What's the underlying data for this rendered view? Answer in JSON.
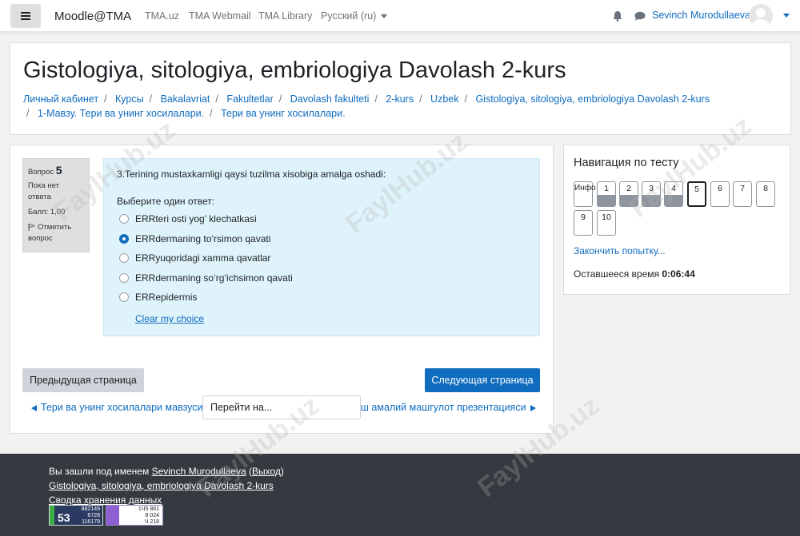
{
  "navbar": {
    "brand": "Moodle@TMA",
    "links": [
      "TMA.uz",
      "TMA Webmail",
      "TMA Library"
    ],
    "language": "Русский (ru)",
    "user": "Sevinch Murodullaeva"
  },
  "header": {
    "title": "Gistologiya, sitologiya, embriologiya Davolash 2-kurs",
    "breadcrumb": [
      "Личный кабинет",
      "Курсы",
      "Bakalavriat",
      "Fakultetlar",
      "Davolash fakulteti",
      "2-kurs",
      "Uzbek",
      "Gistologiya, sitologiya, embriologiya Davolash 2-kurs",
      "1-Мавзу. Тери ва унинг хосилалари.",
      "Тери ва унинг хосилалари."
    ]
  },
  "question_info": {
    "label": "Вопрос",
    "number": "5",
    "status": "Пока нет ответа",
    "grade": "Балл: 1,00",
    "flag": "Отметить вопрос"
  },
  "question": {
    "text": "3.Terining mustaxkamligi qaysi tuzilma xisobiga amalga oshadi:",
    "prompt": "Выберите один ответ:",
    "options": [
      {
        "label": "ERRteri osti yog’ klechatkasi",
        "checked": false
      },
      {
        "label": "ERRdermaning to‘rsimon qavati",
        "checked": true
      },
      {
        "label": "ERRyuqoridagi xamma qavatlar",
        "checked": false
      },
      {
        "label": "ERRdermaning so‘rg‘ichsimon qavati",
        "checked": false
      },
      {
        "label": "ERRepidermis",
        "checked": false
      }
    ],
    "clear": "Clear my choice"
  },
  "buttons": {
    "prev": "Предыдущая страница",
    "next": "Следующая страница"
  },
  "activity_nav": {
    "prev": "Тери ва унинг хосилалари мавзуси",
    "jump": "Перейти на...",
    "next": "Нафас олиш амалий машгулот презентацияси"
  },
  "quiz_nav": {
    "title": "Навигация по тесту",
    "info_label": "Инфо",
    "buttons": [
      {
        "label": "1",
        "state": "answered"
      },
      {
        "label": "2",
        "state": "answered"
      },
      {
        "label": "3",
        "state": "answered"
      },
      {
        "label": "4",
        "state": "answered"
      },
      {
        "label": "5",
        "state": "current"
      },
      {
        "label": "6",
        "state": "empty"
      },
      {
        "label": "7",
        "state": "empty"
      },
      {
        "label": "8",
        "state": "empty"
      },
      {
        "label": "9",
        "state": "empty"
      },
      {
        "label": "10",
        "state": "empty"
      }
    ],
    "finish": "Закончить попытку...",
    "time_label": "Оставшееся время",
    "time_value": "0:06:44"
  },
  "footer": {
    "logged_in_prefix": "Вы зашли под именем",
    "user": "Sevinch Murodullaeva",
    "logout": "Выход",
    "course": "Gistologiya, sitologiya, embriologiya Davolash 2-kurs",
    "data_summary": "Сводка хранения данных",
    "counter1": {
      "big": "53",
      "lines": [
        "882149",
        "6728",
        "116179"
      ]
    },
    "counter2": {
      "lines": [
        "1Ч5 861",
        "8 024",
        "Ч 218"
      ]
    }
  },
  "watermark": "FaylHub.uz",
  "colors": {
    "link": "#0f6cbf",
    "footer": "#343a40",
    "question_bg": "#dff3fb"
  }
}
